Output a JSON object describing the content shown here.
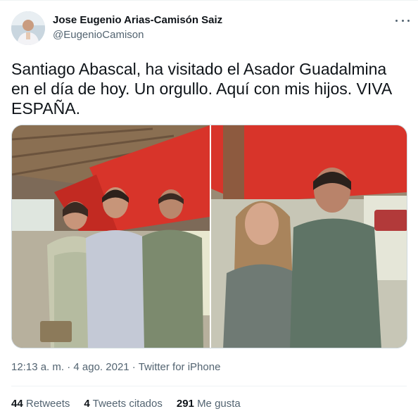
{
  "tweet": {
    "author_name": "Jose Eugenio Arias-Camisón Saiz",
    "author_handle": "@EugenioCamison",
    "text": "Santiago Abascal, ha visitado el Asador Guadalmina en el día de hoy. Un orgullo. Aquí con mis hijos. VIVA ESPAÑA.",
    "time": "12:13 a. m.",
    "date": "4 ago. 2021",
    "source": "Twitter for iPhone",
    "separator": " · "
  },
  "stats": {
    "retweets_count": "44",
    "retweets_label": "Retweets",
    "quotes_count": "4",
    "quotes_label": "Tweets citados",
    "likes_count": "291",
    "likes_label": "Me gusta"
  },
  "icons": {
    "more": "more-options-icon"
  },
  "colors": {
    "text_primary": "#0f1419",
    "text_secondary": "#536471",
    "divider": "#eff3f4",
    "awning_red": "#d8342a"
  }
}
